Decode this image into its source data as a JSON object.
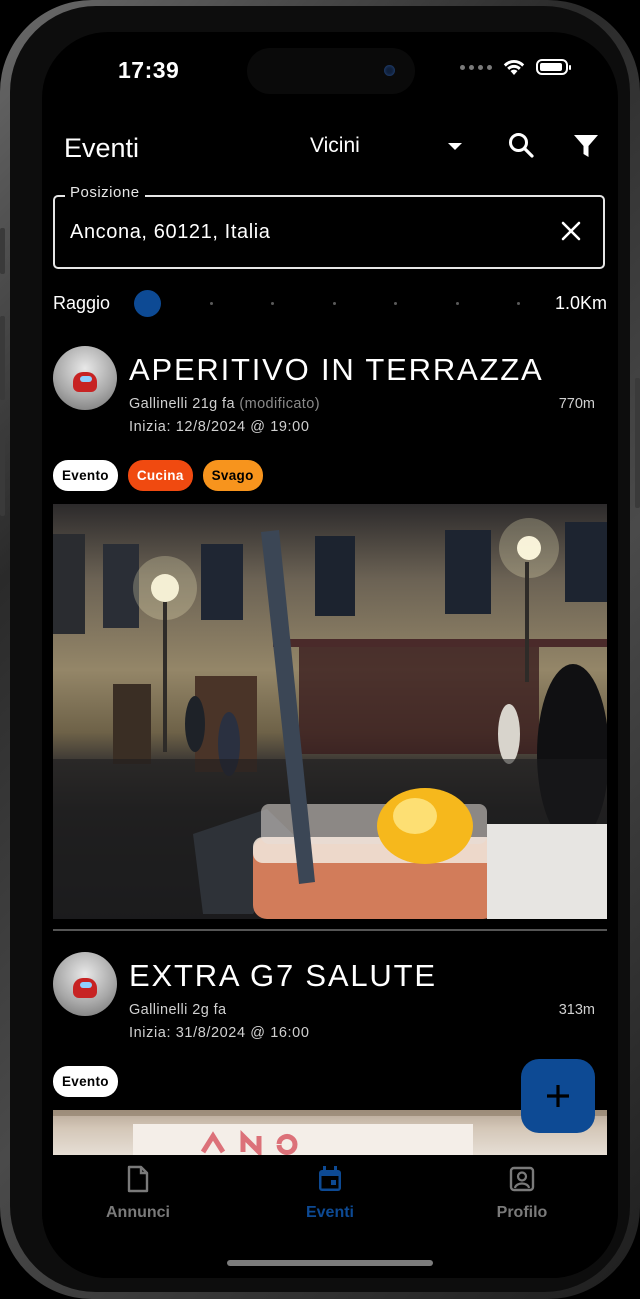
{
  "status_bar": {
    "time": "17:39"
  },
  "app_bar": {
    "title": "Eventi",
    "filter_dropdown": {
      "selected": "Vicini"
    },
    "search_icon": "search-icon",
    "filter_icon": "funnel-icon"
  },
  "location_field": {
    "label": "Posizione",
    "value": "Ancona, 60121, Italia"
  },
  "radius": {
    "label": "Raggio",
    "value_text": "1.0Km",
    "slider_fraction": 0.0
  },
  "posts": [
    {
      "title": "APERITIVO IN TERRAZZA",
      "author_time": "Gallinelli 21g fa",
      "modified": "(modificato)",
      "distance": "770m",
      "start_label": "Inizia:",
      "start_value": "12/8/2024 @ 19:00",
      "tags": [
        "Evento",
        "Cucina",
        "Svago"
      ]
    },
    {
      "title": "EXTRA G7 SALUTE",
      "author_time": "Gallinelli 2g fa",
      "distance": "313m",
      "start_label": "Inizia:",
      "start_value": "31/8/2024 @ 16:00",
      "tags": [
        "Evento"
      ]
    }
  ],
  "fab": {
    "icon": "plus-icon"
  },
  "bottom_nav": {
    "items": [
      {
        "label": "Annunci",
        "icon": "document-icon",
        "active": false
      },
      {
        "label": "Eventi",
        "icon": "calendar-icon",
        "active": true
      },
      {
        "label": "Profilo",
        "icon": "profile-icon",
        "active": false
      }
    ]
  },
  "colors": {
    "accent": "#0d4a94",
    "chip_red": "#f04a10",
    "chip_orange": "#f7941d",
    "background": "#000000"
  }
}
